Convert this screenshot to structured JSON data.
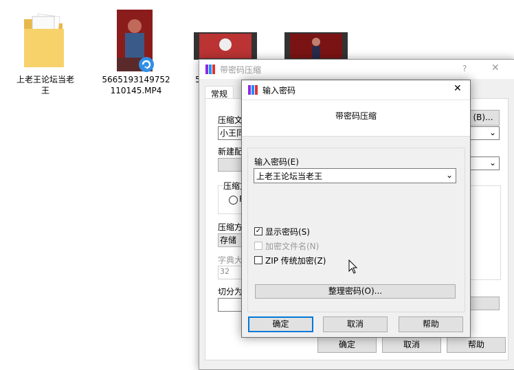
{
  "desktop": {
    "items": [
      {
        "label_line1": "上老王论坛当老",
        "label_line2": "王",
        "type": "folder"
      },
      {
        "label_line1": "5665193149752",
        "label_line2": "110145.MP4",
        "type": "video"
      },
      {
        "label_line1": "5",
        "label_line2": "",
        "type": "video"
      }
    ]
  },
  "back_dialog": {
    "title": "带密码压缩",
    "help_glyph": "?",
    "close_glyph": "✕",
    "tab_general": "常规",
    "label_archive": "压缩文",
    "archive_value": "小王同",
    "browse_label": "(B)...",
    "label_new_config": "新建配",
    "label_format": "压缩文",
    "radio_label": "R",
    "label_method": "压缩方",
    "method_value": "存储",
    "label_dict": "字典大",
    "dict_value": "32",
    "label_split": "切分为",
    "ok": "确定",
    "cancel": "取消",
    "help": "帮助"
  },
  "front_dialog": {
    "title": "输入密码",
    "close_glyph": "✕",
    "header": "带密码压缩",
    "password_label": "输入密码(E)",
    "password_value": "上老王论坛当老王",
    "show_password": "显示密码(S)",
    "show_password_checked": true,
    "encrypt_filenames": "加密文件名(N)",
    "encrypt_filenames_checked": false,
    "zip_legacy": "ZIP 传统加密(Z)",
    "zip_legacy_checked": false,
    "organize": "整理密码(O)...",
    "ok": "确定",
    "cancel": "取消",
    "help": "帮助"
  }
}
